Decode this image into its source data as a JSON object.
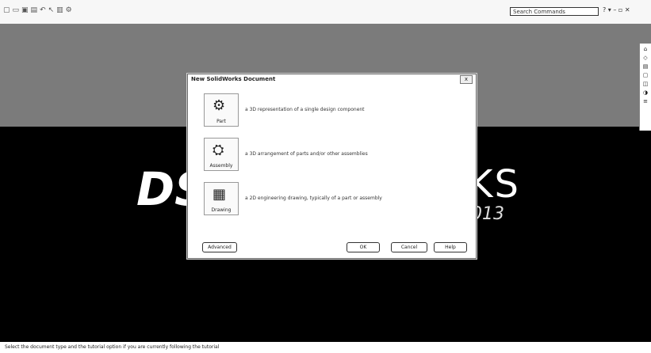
{
  "app": {
    "toolbar_icons": [
      "new-icon",
      "open-icon",
      "save-icon",
      "print-icon",
      "undo-icon",
      "select-icon",
      "rebuild-icon",
      "options-icon"
    ],
    "search_placeholder": "Search Commands",
    "right_tools": "? ▾ – ▫ ✕"
  },
  "taskpane": {
    "icons": [
      "home-icon",
      "resources-icon",
      "library-icon",
      "explorer-icon",
      "view-palette-icon",
      "appearances-icon",
      "custom-props-icon"
    ]
  },
  "splash": {
    "brand_left": "DS",
    "brand_right": "KS",
    "year": "013"
  },
  "dialog": {
    "title": "New SolidWorks Document",
    "close": "x",
    "options": [
      {
        "label": "Part",
        "icon": "part-icon",
        "glyph": "⚙",
        "description": "a 3D representation of a single design component"
      },
      {
        "label": "Assembly",
        "icon": "assembly-icon",
        "glyph": "⛭",
        "description": "a 3D arrangement of parts and/or other assemblies"
      },
      {
        "label": "Drawing",
        "icon": "drawing-icon",
        "glyph": "▦",
        "description": "a 2D engineering drawing, typically of a part or assembly"
      }
    ],
    "buttons": {
      "advanced": "Advanced",
      "ok": "OK",
      "cancel": "Cancel",
      "help": "Help"
    }
  },
  "status_bar": {
    "text": "Select the document type and the tutorial option if you are currently following the tutorial"
  }
}
